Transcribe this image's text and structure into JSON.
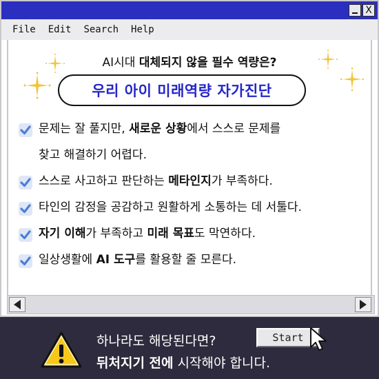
{
  "window": {
    "buttons": {
      "minimize": "_",
      "close": "X"
    },
    "title_bar_color": "#2b2fbf"
  },
  "menu": {
    "items": [
      {
        "label": "File"
      },
      {
        "label": "Edit"
      },
      {
        "label": "Search"
      },
      {
        "label": "Help"
      }
    ]
  },
  "content": {
    "subheading_prefix": "AI시대 ",
    "subheading_bold": "대체되지 않을 필수 역량은?",
    "title_pill": "우리 아이 미래역량 자가진단",
    "checklist": [
      {
        "segments": [
          {
            "text": "문제는 잘 풀지만, ",
            "bold": false
          },
          {
            "text": "새로운 상황",
            "bold": true
          },
          {
            "text": "에서 스스로 문제를",
            "bold": false
          }
        ]
      },
      {
        "segments": [
          {
            "text": "스스로 사고하고 판단하는 ",
            "bold": false
          },
          {
            "text": "메타인지",
            "bold": true
          },
          {
            "text": "가 부족하다.",
            "bold": false
          }
        ]
      },
      {
        "segments": [
          {
            "text": "타인의 감정을 공감하고 원활하게 소통하는 데 서툴다.",
            "bold": false
          }
        ]
      },
      {
        "segments": [
          {
            "text": "자기 이해",
            "bold": true
          },
          {
            "text": "가 부족하고 ",
            "bold": false
          },
          {
            "text": "미래 목표",
            "bold": true
          },
          {
            "text": "도 막연하다.",
            "bold": false
          }
        ]
      },
      {
        "segments": [
          {
            "text": "일상생활에 ",
            "bold": false
          },
          {
            "text": "AI 도구",
            "bold": true
          },
          {
            "text": "를 활용할 줄 모른다.",
            "bold": false
          }
        ]
      }
    ],
    "item1_continuation": "찾고 해결하기 어렵다."
  },
  "footer": {
    "line1": "하나라도 해당된다면?",
    "line2_bold": "뒤처지기 전에",
    "line2_rest": " 시작해야 합니다.",
    "start_button": "Start"
  },
  "colors": {
    "accent_blue": "#2525c9",
    "check_blue": "#4a7fd6",
    "sparkle_yellow": "#f2c53d",
    "footer_bg": "#2d2b3d",
    "warning_yellow": "#f6c81a"
  },
  "icons": [
    "minimize-icon",
    "close-icon",
    "sparkle-icon",
    "check-icon",
    "left-arrow-icon",
    "right-arrow-icon",
    "warning-icon",
    "cursor-icon"
  ]
}
